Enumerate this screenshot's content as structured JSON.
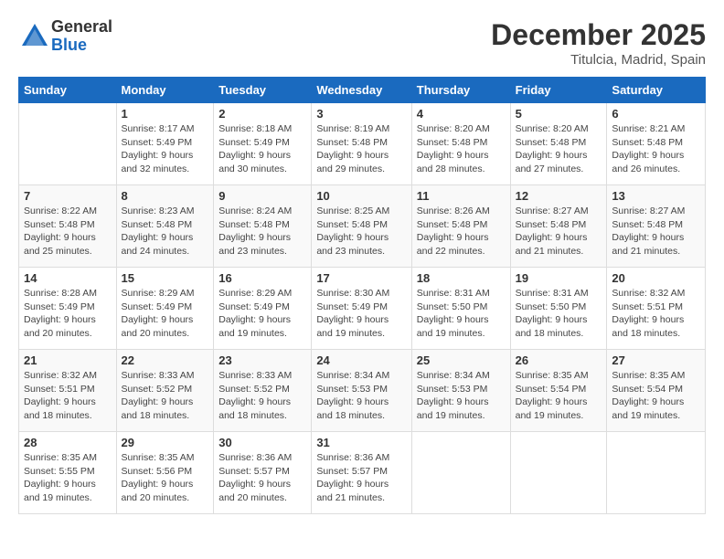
{
  "header": {
    "logo": {
      "general": "General",
      "blue": "Blue"
    },
    "title": "December 2025",
    "location": "Titulcia, Madrid, Spain"
  },
  "calendar": {
    "days_of_week": [
      "Sunday",
      "Monday",
      "Tuesday",
      "Wednesday",
      "Thursday",
      "Friday",
      "Saturday"
    ],
    "weeks": [
      [
        {
          "day": "",
          "info": ""
        },
        {
          "day": "1",
          "info": "Sunrise: 8:17 AM\nSunset: 5:49 PM\nDaylight: 9 hours\nand 32 minutes."
        },
        {
          "day": "2",
          "info": "Sunrise: 8:18 AM\nSunset: 5:49 PM\nDaylight: 9 hours\nand 30 minutes."
        },
        {
          "day": "3",
          "info": "Sunrise: 8:19 AM\nSunset: 5:48 PM\nDaylight: 9 hours\nand 29 minutes."
        },
        {
          "day": "4",
          "info": "Sunrise: 8:20 AM\nSunset: 5:48 PM\nDaylight: 9 hours\nand 28 minutes."
        },
        {
          "day": "5",
          "info": "Sunrise: 8:20 AM\nSunset: 5:48 PM\nDaylight: 9 hours\nand 27 minutes."
        },
        {
          "day": "6",
          "info": "Sunrise: 8:21 AM\nSunset: 5:48 PM\nDaylight: 9 hours\nand 26 minutes."
        }
      ],
      [
        {
          "day": "7",
          "info": "Sunrise: 8:22 AM\nSunset: 5:48 PM\nDaylight: 9 hours\nand 25 minutes."
        },
        {
          "day": "8",
          "info": "Sunrise: 8:23 AM\nSunset: 5:48 PM\nDaylight: 9 hours\nand 24 minutes."
        },
        {
          "day": "9",
          "info": "Sunrise: 8:24 AM\nSunset: 5:48 PM\nDaylight: 9 hours\nand 23 minutes."
        },
        {
          "day": "10",
          "info": "Sunrise: 8:25 AM\nSunset: 5:48 PM\nDaylight: 9 hours\nand 23 minutes."
        },
        {
          "day": "11",
          "info": "Sunrise: 8:26 AM\nSunset: 5:48 PM\nDaylight: 9 hours\nand 22 minutes."
        },
        {
          "day": "12",
          "info": "Sunrise: 8:27 AM\nSunset: 5:48 PM\nDaylight: 9 hours\nand 21 minutes."
        },
        {
          "day": "13",
          "info": "Sunrise: 8:27 AM\nSunset: 5:48 PM\nDaylight: 9 hours\nand 21 minutes."
        }
      ],
      [
        {
          "day": "14",
          "info": "Sunrise: 8:28 AM\nSunset: 5:49 PM\nDaylight: 9 hours\nand 20 minutes."
        },
        {
          "day": "15",
          "info": "Sunrise: 8:29 AM\nSunset: 5:49 PM\nDaylight: 9 hours\nand 20 minutes."
        },
        {
          "day": "16",
          "info": "Sunrise: 8:29 AM\nSunset: 5:49 PM\nDaylight: 9 hours\nand 19 minutes."
        },
        {
          "day": "17",
          "info": "Sunrise: 8:30 AM\nSunset: 5:49 PM\nDaylight: 9 hours\nand 19 minutes."
        },
        {
          "day": "18",
          "info": "Sunrise: 8:31 AM\nSunset: 5:50 PM\nDaylight: 9 hours\nand 19 minutes."
        },
        {
          "day": "19",
          "info": "Sunrise: 8:31 AM\nSunset: 5:50 PM\nDaylight: 9 hours\nand 18 minutes."
        },
        {
          "day": "20",
          "info": "Sunrise: 8:32 AM\nSunset: 5:51 PM\nDaylight: 9 hours\nand 18 minutes."
        }
      ],
      [
        {
          "day": "21",
          "info": "Sunrise: 8:32 AM\nSunset: 5:51 PM\nDaylight: 9 hours\nand 18 minutes."
        },
        {
          "day": "22",
          "info": "Sunrise: 8:33 AM\nSunset: 5:52 PM\nDaylight: 9 hours\nand 18 minutes."
        },
        {
          "day": "23",
          "info": "Sunrise: 8:33 AM\nSunset: 5:52 PM\nDaylight: 9 hours\nand 18 minutes."
        },
        {
          "day": "24",
          "info": "Sunrise: 8:34 AM\nSunset: 5:53 PM\nDaylight: 9 hours\nand 18 minutes."
        },
        {
          "day": "25",
          "info": "Sunrise: 8:34 AM\nSunset: 5:53 PM\nDaylight: 9 hours\nand 19 minutes."
        },
        {
          "day": "26",
          "info": "Sunrise: 8:35 AM\nSunset: 5:54 PM\nDaylight: 9 hours\nand 19 minutes."
        },
        {
          "day": "27",
          "info": "Sunrise: 8:35 AM\nSunset: 5:54 PM\nDaylight: 9 hours\nand 19 minutes."
        }
      ],
      [
        {
          "day": "28",
          "info": "Sunrise: 8:35 AM\nSunset: 5:55 PM\nDaylight: 9 hours\nand 19 minutes."
        },
        {
          "day": "29",
          "info": "Sunrise: 8:35 AM\nSunset: 5:56 PM\nDaylight: 9 hours\nand 20 minutes."
        },
        {
          "day": "30",
          "info": "Sunrise: 8:36 AM\nSunset: 5:57 PM\nDaylight: 9 hours\nand 20 minutes."
        },
        {
          "day": "31",
          "info": "Sunrise: 8:36 AM\nSunset: 5:57 PM\nDaylight: 9 hours\nand 21 minutes."
        },
        {
          "day": "",
          "info": ""
        },
        {
          "day": "",
          "info": ""
        },
        {
          "day": "",
          "info": ""
        }
      ]
    ]
  }
}
